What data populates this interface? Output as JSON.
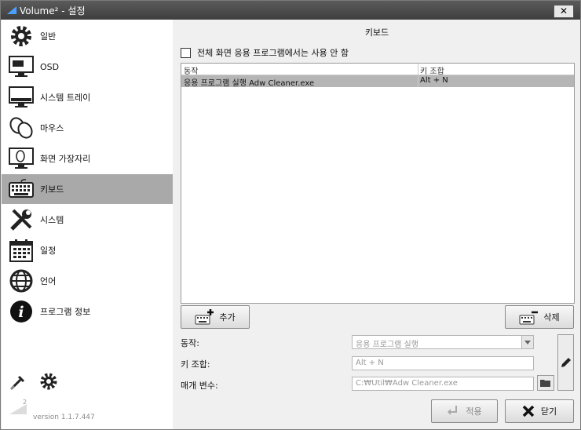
{
  "window": {
    "title": "Volume² - 설정",
    "close_glyph": "✕"
  },
  "sidebar": {
    "items": [
      {
        "label": "일반",
        "icon": "gear-icon"
      },
      {
        "label": "OSD",
        "icon": "monitor-icon"
      },
      {
        "label": "시스템 트레이",
        "icon": "tray-monitor-icon"
      },
      {
        "label": "마우스",
        "icon": "mouse-icon"
      },
      {
        "label": "화면 가장자리",
        "icon": "screen-edge-icon"
      },
      {
        "label": "키보드",
        "icon": "keyboard-icon",
        "active": true
      },
      {
        "label": "시스템",
        "icon": "tools-icon"
      },
      {
        "label": "일정",
        "icon": "calendar-icon"
      },
      {
        "label": "언어",
        "icon": "globe-icon"
      },
      {
        "label": "프로그램 정보",
        "icon": "info-icon"
      }
    ],
    "version": "version 1.1.7.447",
    "logo_text": "2"
  },
  "main": {
    "title": "키보드",
    "fullscreen_checkbox_label": "전체 화면 응용 프로그램에서는 사용 안 함",
    "table": {
      "headers": [
        "동작",
        "키 조합"
      ],
      "rows": [
        {
          "action": "응용 프로그램 실행 Adw Cleaner.exe",
          "keys": "Alt + N",
          "selected": true
        }
      ]
    },
    "add_label": "추가",
    "delete_label": "삭제",
    "form": {
      "action_label": "동작:",
      "action_value": "응용 프로그램 실행",
      "keys_label": "키 조합:",
      "keys_value": "Alt + N",
      "param_label": "매개 변수:",
      "param_value": "C:₩Util₩Adw Cleaner.exe"
    },
    "apply_label": "적용",
    "close_label": "닫기"
  },
  "colors": {
    "active_item": "#a9a9a9",
    "selected_row": "#b5b5b5",
    "titlebar": "#4a4a4a"
  }
}
